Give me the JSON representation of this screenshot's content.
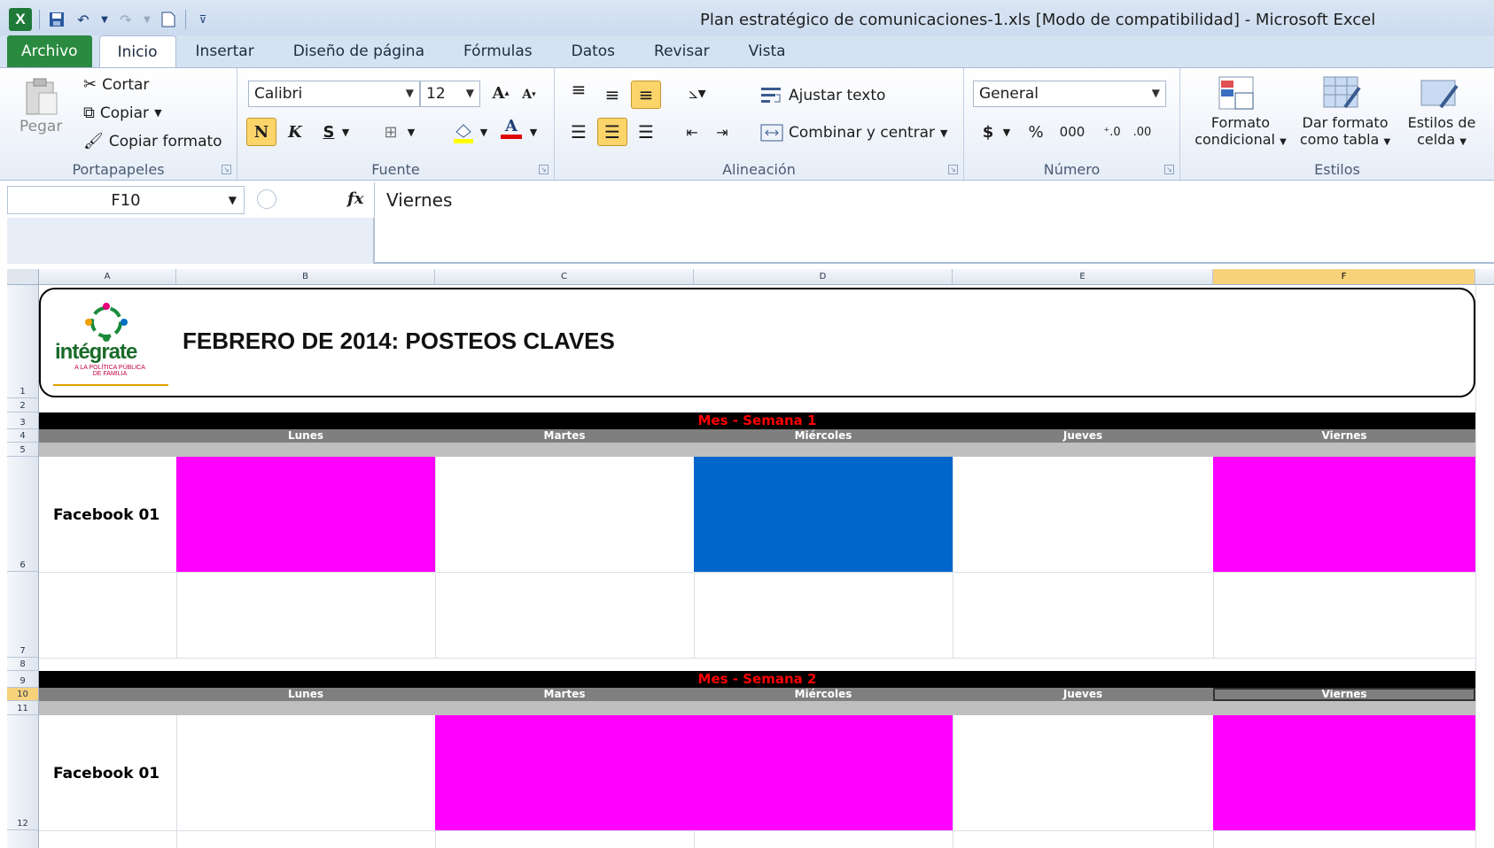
{
  "window": {
    "title": "Plan estratégico de comunicaciones-1.xls  [Modo de compatibilidad]  -  Microsoft Excel",
    "logo": "X"
  },
  "tabs": [
    "Archivo",
    "Inicio",
    "Insertar",
    "Diseño de página",
    "Fórmulas",
    "Datos",
    "Revisar",
    "Vista"
  ],
  "ribbon": {
    "clipboard": {
      "paste": "Pegar",
      "cut": "Cortar",
      "copy": "Copiar",
      "format_painter": "Copiar formato",
      "label": "Portapapeles"
    },
    "font": {
      "name": "Calibri",
      "size": "12",
      "bold": "N",
      "italic": "K",
      "underline": "S",
      "label": "Fuente"
    },
    "alignment": {
      "wrap": "Ajustar texto",
      "merge": "Combinar y centrar",
      "label": "Alineación"
    },
    "number": {
      "format": "General",
      "currency": "$",
      "percent": "%",
      "thousands": "000",
      "label": "Número"
    },
    "styles": {
      "conditional": [
        "Formato",
        "condicional"
      ],
      "as_table": [
        "Dar formato",
        "como tabla"
      ],
      "cell_styles": [
        "Estilos de",
        "celda"
      ],
      "label": "Estilos"
    }
  },
  "formula_bar": {
    "name_box": "F10",
    "fx": "fx",
    "value": "Viernes"
  },
  "columns": [
    "A",
    "B",
    "C",
    "D",
    "E",
    "F"
  ],
  "rows": [
    "1",
    "2",
    "3",
    "4",
    "5",
    "6",
    "7",
    "8",
    "9",
    "10",
    "11",
    "12"
  ],
  "sheet": {
    "logo_text": "intégrate",
    "logo_sub1": "A LA POLÍTICA PÚBLICA",
    "logo_sub2": "DE FAMILIA",
    "header_title": "FEBRERO DE 2014: POSTEOS CLAVES",
    "weeks": [
      {
        "title": "Mes - Semana 1",
        "days": [
          "Lunes",
          "Martes",
          "Miércoles",
          "Jueves",
          "Viernes"
        ],
        "row_label": "Facebook 01"
      },
      {
        "title": "Mes - Semana 2",
        "days": [
          "Lunes",
          "Martes",
          "Miércoles",
          "Jueves",
          "Viernes"
        ],
        "row_label": "Facebook 01"
      }
    ],
    "colors": {
      "magenta": "#ff00ff",
      "blue": "#0066cc",
      "week_title": "#ff0000"
    }
  }
}
